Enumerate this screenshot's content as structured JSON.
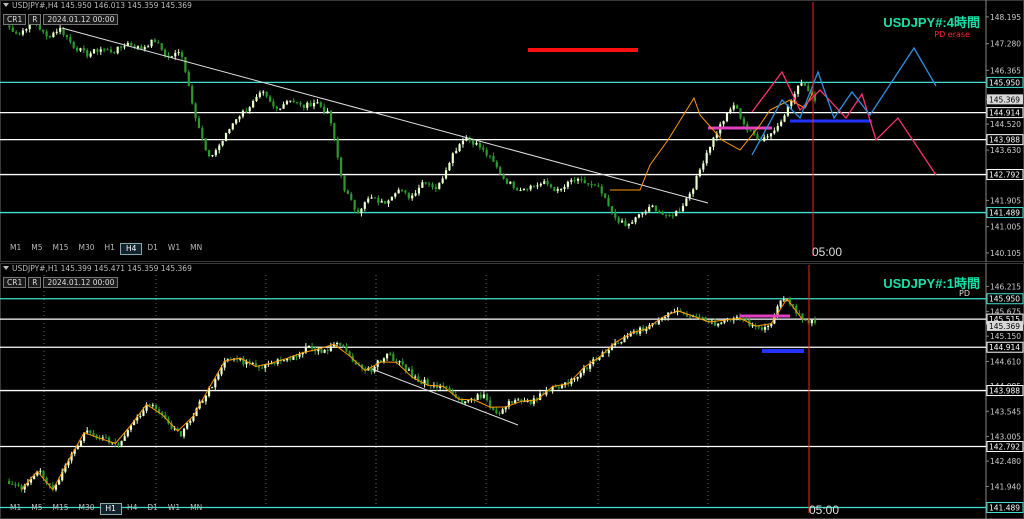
{
  "panels": [
    {
      "id": "h4",
      "header": "USDJPY#,H4  145.950 146.013 145.359 145.369",
      "date_label": "2024.01.12 00:00",
      "buttons": [
        "CR1",
        "R"
      ],
      "title": "USDJPY#:4時間",
      "subtitle": "PD erase",
      "timeframes": [
        "M1",
        "M5",
        "M15",
        "M30",
        "H1",
        "H4",
        "D1",
        "W1",
        "MN"
      ],
      "active_timeframe": "H4",
      "time_label": "05:00",
      "price_labels": [
        "148.195",
        "147.280",
        "146.365",
        "145.369",
        "144.520",
        "143.630",
        "142.792",
        "141.905",
        "141.005",
        "140.105"
      ],
      "levels": [
        {
          "label": "145.950",
          "color": "#40e0d0"
        },
        {
          "label": "144.914",
          "color": "#ffffff"
        },
        {
          "label": "143.988",
          "color": "#ffffff"
        },
        {
          "label": "142.792",
          "color": "#ffffff"
        },
        {
          "label": "141.489",
          "color": "#40e0d0"
        }
      ],
      "current_price": "145.369"
    },
    {
      "id": "h1",
      "header": "USDJPY#,H1  145.399 145.471 145.359 145.369",
      "date_label": "2024.01.12 00:00",
      "buttons": [
        "CR1",
        "R"
      ],
      "title": "USDJPY#:1時間",
      "subtitle": "PD",
      "timeframes": [
        "M1",
        "M5",
        "M15",
        "M30",
        "H1",
        "H4",
        "D1",
        "W1",
        "MN"
      ],
      "active_timeframe": "H1",
      "time_label": "05:00",
      "price_labels": [
        "146.215",
        "145.675",
        "145.150",
        "144.610",
        "144.085",
        "143.545",
        "143.005",
        "142.480",
        "141.940"
      ],
      "levels": [
        {
          "label": "145.950",
          "color": "#40e0d0"
        },
        {
          "label": "145.515",
          "color": "#ffffff"
        },
        {
          "label": "144.914",
          "color": "#ffffff"
        },
        {
          "label": "143.988",
          "color": "#ffffff"
        },
        {
          "label": "142.792",
          "color": "#ffffff"
        },
        {
          "label": "141.489",
          "color": "#40e0d0"
        }
      ],
      "current_price": "145.369"
    }
  ],
  "colors": {
    "bull": "#e8ffd0",
    "bear": "#2d9a2d",
    "zigzag": "#ff9900",
    "trendline": "#e0e0e0",
    "cyan_level": "#40e0d0",
    "marker_red": "#ff1010",
    "marker_magenta": "#e040c0",
    "marker_blue": "#2233ff",
    "projection_pink": "#ff3070",
    "projection_blue": "#3090e0",
    "vline": "#ff2020"
  },
  "chart_data": [
    {
      "type": "candlestick",
      "title": "USDJPY#:4時間",
      "symbol": "USDJPY#",
      "timeframe": "H4",
      "ylim": [
        140.0,
        148.5
      ],
      "close_path": [
        147.9,
        147.6,
        148.1,
        147.5,
        147.8,
        147.2,
        146.9,
        147.1,
        147.0,
        147.3,
        147.1,
        147.4,
        146.8,
        147.0,
        144.9,
        143.3,
        143.9,
        144.7,
        145.1,
        145.6,
        145.0,
        145.4,
        145.1,
        145.3,
        144.8,
        142.4,
        141.5,
        142.0,
        141.8,
        142.3,
        142.0,
        142.6,
        142.3,
        143.4,
        144.1,
        143.8,
        143.3,
        142.6,
        142.3,
        142.4,
        142.5,
        142.2,
        142.6,
        142.5,
        142.3,
        141.4,
        141.0,
        141.4,
        141.7,
        141.3,
        141.6,
        142.4,
        143.6,
        144.5,
        145.2,
        144.3,
        144.0,
        144.3,
        145.1,
        146.0,
        145.4
      ],
      "levels": [
        145.95,
        144.914,
        143.988,
        142.792,
        141.489
      ],
      "last_price": 145.369
    },
    {
      "type": "candlestick",
      "title": "USDJPY#:1時間",
      "symbol": "USDJPY#",
      "timeframe": "H1",
      "ylim": [
        141.35,
        146.5
      ],
      "close_path": [
        142.0,
        141.9,
        142.3,
        141.8,
        142.6,
        143.1,
        143.0,
        142.8,
        143.3,
        143.7,
        143.4,
        143.0,
        143.6,
        144.1,
        144.7,
        144.6,
        144.5,
        144.6,
        144.7,
        144.9,
        144.8,
        145.0,
        144.6,
        144.4,
        144.8,
        144.5,
        144.2,
        144.1,
        144.0,
        143.7,
        143.9,
        143.5,
        143.8,
        143.7,
        144.0,
        144.1,
        144.3,
        144.6,
        144.9,
        145.1,
        145.3,
        145.4,
        145.7,
        145.6,
        145.5,
        145.4,
        145.6,
        145.4,
        145.3,
        146.0,
        145.6,
        145.4
      ],
      "levels": [
        145.95,
        145.515,
        144.914,
        143.988,
        142.792,
        141.489
      ],
      "last_price": 145.369
    }
  ]
}
